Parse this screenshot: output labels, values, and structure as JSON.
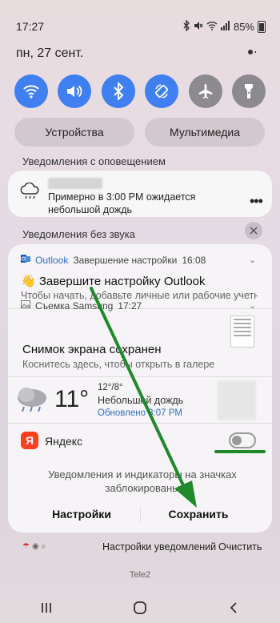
{
  "status": {
    "time": "17:27",
    "battery": "85%"
  },
  "date": "пн, 27 сент.",
  "quick_toggles": [
    {
      "name": "wifi-icon",
      "on": true
    },
    {
      "name": "sound-icon",
      "on": true
    },
    {
      "name": "bluetooth-icon",
      "on": true
    },
    {
      "name": "autorotate-icon",
      "on": true
    },
    {
      "name": "airplane-icon",
      "on": false
    },
    {
      "name": "flashlight-icon",
      "on": false
    }
  ],
  "pills": {
    "devices": "Устройства",
    "media": "Мультимедиа"
  },
  "sections": {
    "alerting": "Уведомления с оповещением",
    "silent": "Уведомления без звука"
  },
  "weather_notification": {
    "text": "Примерно в 3:00 PM ожидается небольшой дождь"
  },
  "outlook": {
    "app": "Outlook",
    "subtitle": "Завершение настройки",
    "time": "16:08",
    "title": "👋 Завершите настройку Outlook",
    "text": "Чтобы начать, добавьте личные или рабочие учетн..."
  },
  "screenshot": {
    "app": "Съемка Samsung",
    "time": "17:27",
    "title": "Снимок экрана сохранен",
    "text": "Коснитесь здесь, чтобы открыть в галерее."
  },
  "weather_widget": {
    "temp": "11°",
    "range": "12°/8°",
    "desc": "Небольшой дождь",
    "updated": "Обновлено 3:07 PM"
  },
  "yandex": {
    "icon_letter": "Я",
    "label": "Яндекс",
    "toggle_on": false,
    "message": "Уведомления и индикаторы на значках заблокированы"
  },
  "actions": {
    "settings": "Настройки",
    "save": "Сохранить"
  },
  "bottom": {
    "settings": "Настройки уведомлений",
    "clear": "Очистить",
    "carrier": "Tele2"
  },
  "colors": {
    "accent": "#3f7ff0",
    "toggle_off": "#8d8a8f",
    "highlight": "#1f8a2a",
    "yandex": "#fc3f1d"
  }
}
